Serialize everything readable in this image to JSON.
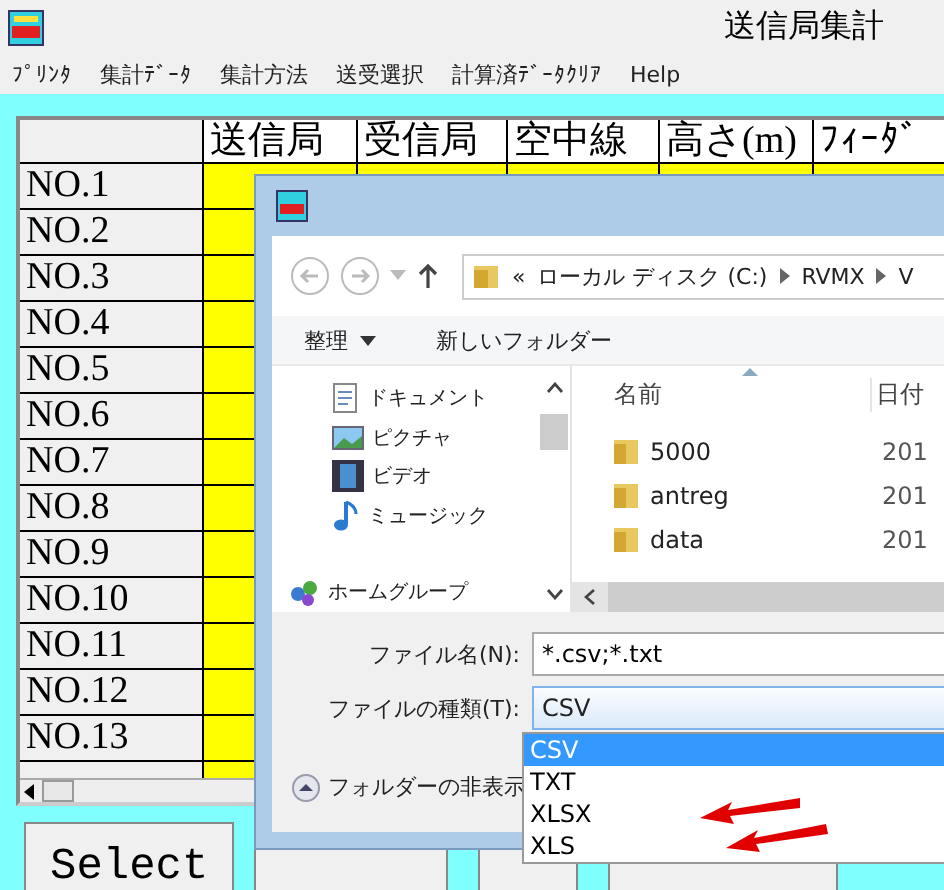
{
  "window": {
    "title": "送信局集計"
  },
  "menu": [
    "ﾌﾟﾘﾝﾀ",
    "集計ﾃﾞｰﾀ",
    "集計方法",
    "送受選択",
    "計算済ﾃﾞｰﾀｸﾘｱ",
    "Help"
  ],
  "grid": {
    "columns": [
      "送信局",
      "受信局",
      "空中線",
      "高さ(m)",
      "ﾌｨｰﾀﾞ"
    ],
    "rows": [
      "NO.1",
      "NO.2",
      "NO.3",
      "NO.4",
      "NO.5",
      "NO.6",
      "NO.7",
      "NO.8",
      "NO.9",
      "NO.10",
      "NO.11",
      "NO.12",
      "NO.13"
    ]
  },
  "buttons": [
    "Select"
  ],
  "dialog": {
    "address_prefix": "«",
    "address": [
      "ローカル ディスク (C:)",
      "RVMX",
      "V"
    ],
    "toolbar": [
      "整理",
      "新しいフォルダー"
    ],
    "nav_items": [
      {
        "label": "ドキュメント",
        "kind": "document"
      },
      {
        "label": "ピクチャ",
        "kind": "picture"
      },
      {
        "label": "ビデオ",
        "kind": "video"
      },
      {
        "label": "ミュージック",
        "kind": "music"
      },
      {
        "label": "ホームグループ",
        "kind": "homegroup"
      }
    ],
    "columns": [
      "名前",
      "日付"
    ],
    "files": [
      {
        "name": "5000",
        "date": "201"
      },
      {
        "name": "antreg",
        "date": "201"
      },
      {
        "name": "data",
        "date": "201"
      }
    ],
    "file_name": {
      "label": "ファイル名(N):",
      "value": "*.csv;*.txt"
    },
    "file_type": {
      "label": "ファイルの種類(T):",
      "value": "CSV",
      "options": [
        {
          "label": "CSV",
          "selected": true
        },
        {
          "label": "TXT",
          "selected": false
        },
        {
          "label": "XLSX",
          "selected": false
        },
        {
          "label": "XLS",
          "selected": false
        }
      ]
    },
    "hide_folders": "フォルダーの非表示"
  }
}
